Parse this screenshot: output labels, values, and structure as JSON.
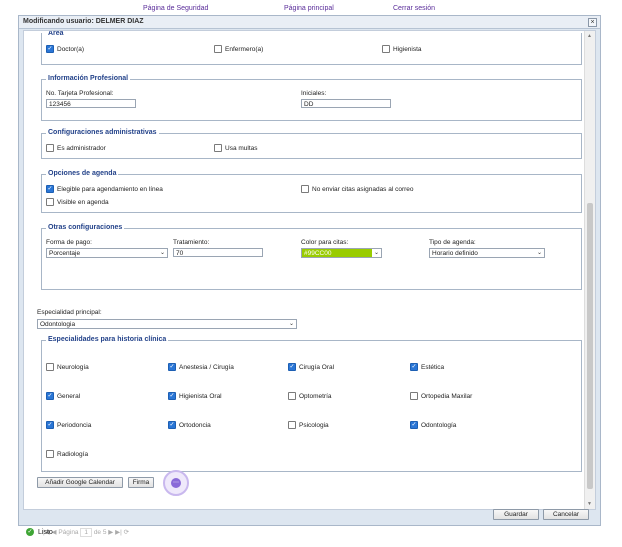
{
  "nav": {
    "security": "Página de Seguridad",
    "main": "Página principal",
    "logout": "Cerrar sesión"
  },
  "dialog": {
    "title": "Modificando usuario: DELMER DIAZ",
    "close": "×"
  },
  "area": {
    "legend": "Área",
    "doctor": "Doctor(a)",
    "nurse": "Enfermero(a)",
    "hygienist": "Higienista"
  },
  "professional": {
    "legend": "Información Profesional",
    "card_label": "No. Tarjeta Profesional:",
    "card_value": "123456",
    "initials_label": "Iniciales:",
    "initials_value": "DD"
  },
  "admin": {
    "legend": "Configuraciones administrativas",
    "is_admin": "Es administrador",
    "fines": "Usa multas"
  },
  "agenda": {
    "legend": "Opciones de agenda",
    "eligible": "Elegible para agendamiento en línea",
    "no_send": "No enviar citas asignadas al correo",
    "visible": "Visible en agenda"
  },
  "other": {
    "legend": "Otras configuraciones",
    "pay_label": "Forma de pago:",
    "pay_value": "Porcentaje",
    "treat_label": "Tratamiento:",
    "treat_value": "70",
    "color_label": "Color para citas:",
    "color_value": "#99CC00",
    "color_hex": "#99cc00",
    "type_label": "Tipo de agenda:",
    "type_value": "Horario definido"
  },
  "specialty": {
    "label": "Especialidad principal:",
    "value": "Odontologia"
  },
  "history": {
    "legend": "Especialidades para historia clínica",
    "items": [
      {
        "label": "Neurología",
        "checked": false
      },
      {
        "label": "Anestesia / Cirugía",
        "checked": true
      },
      {
        "label": "Cirugía Oral",
        "checked": true
      },
      {
        "label": "Estética",
        "checked": true
      },
      {
        "label": "General",
        "checked": true
      },
      {
        "label": "Higienista Oral",
        "checked": true
      },
      {
        "label": "Optometría",
        "checked": false
      },
      {
        "label": "Ortopedia Maxilar",
        "checked": false
      },
      {
        "label": "Periodoncia",
        "checked": true
      },
      {
        "label": "Ortodoncia",
        "checked": true
      },
      {
        "label": "Psicologia",
        "checked": false
      },
      {
        "label": "Odontología",
        "checked": true
      },
      {
        "label": "Radiología",
        "checked": false
      }
    ]
  },
  "buttons": {
    "google": "Añadir Google Calendar",
    "sign": "Firma",
    "save": "Guardar",
    "cancel": "Cancelar"
  },
  "pager": {
    "page_label": "Página",
    "page": "1",
    "of": "de 5"
  },
  "status": {
    "text": "Listo"
  }
}
